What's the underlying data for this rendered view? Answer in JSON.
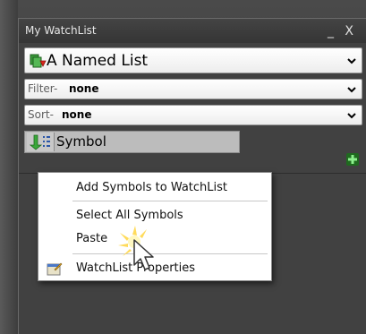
{
  "window": {
    "title": "My WatchList",
    "controls": "_ X"
  },
  "list_selector": {
    "value": "A Named List",
    "icon": "watchlist-icon"
  },
  "filter": {
    "label": "Filter-",
    "value": "none"
  },
  "sort": {
    "label": "Sort-",
    "value": "none"
  },
  "column_header": {
    "label": "Symbol",
    "icon": "sort-order-icon"
  },
  "add_button": {
    "icon": "plus-icon",
    "color": "#2fa82f"
  },
  "context_menu": {
    "items": [
      {
        "label": "Add Symbols to WatchList"
      },
      {
        "label": "Select All Symbols"
      },
      {
        "label": "Paste"
      },
      {
        "label": "WatchList Properties",
        "icon": "properties-icon"
      }
    ]
  },
  "colors": {
    "panel_bg": "#414141",
    "title_text": "#e6e6e6",
    "menu_bg": "#ffffff"
  }
}
